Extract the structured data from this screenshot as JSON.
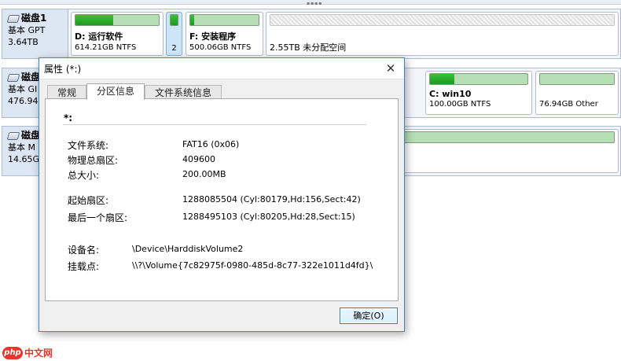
{
  "disks": [
    {
      "name": "磁盘1",
      "type": "基本 GPT",
      "size": "3.64TB",
      "partitions": [
        {
          "title": "D: 运行软件",
          "size": "614.21GB NTFS",
          "usage": 0.45,
          "selected": false
        },
        {
          "title": "",
          "number": "2",
          "usage": 1.0,
          "selected": true
        },
        {
          "title": "F: 安装程序",
          "size": "500.06GB NTFS",
          "usage": 0.06,
          "selected": false
        },
        {
          "title": "",
          "size": "2.55TB 未分配空间",
          "usage": 0,
          "unallocated": true
        }
      ]
    },
    {
      "name": "磁盘",
      "type": "基本 GI",
      "size": "476.94",
      "partitions": [
        {
          "title": "C: win10",
          "size": "100.00GB NTFS",
          "usage": 0.25
        },
        {
          "title": "",
          "size": "76.94GB Other",
          "usage": 0
        }
      ]
    },
    {
      "name": "磁盘",
      "type": "基本 M",
      "size": "14.65G",
      "partitions": [
        {
          "title": "",
          "size": "",
          "usage": 0
        }
      ]
    }
  ],
  "dialog": {
    "title": "属性 (*:)",
    "tabs": [
      "常规",
      "分区信息",
      "文件系统信息"
    ],
    "active_tab": "分区信息",
    "partition_name": "*:",
    "fields": {
      "fs_label": "文件系统:",
      "fs_value": "FAT16 (0x06)",
      "phys_label": "物理总扇区:",
      "phys_value": "409600",
      "total_label": "总大小:",
      "total_value": "200.00MB",
      "start_label": "起始扇区:",
      "start_value": "1288085504  (Cyl:80179,Hd:156,Sect:42)",
      "end_label": "最后一个扇区:",
      "end_value": "1288495103  (Cyl:80205,Hd:28,Sect:15)",
      "dev_label": "设备名:",
      "dev_value": "\\Device\\HarddiskVolume2",
      "mount_label": "挂载点:",
      "mount_value": "\\\\?\\Volume{7c82975f-0980-485d-8c77-322e1011d4fd}\\"
    },
    "ok_label": "确定(O)"
  },
  "watermark": {
    "logo": "php",
    "text": "中文网"
  },
  "colors": {
    "usage_bar": "#2aa52a",
    "selected_partition": "#cde6f7",
    "dialog_border": "#3f86c9"
  }
}
